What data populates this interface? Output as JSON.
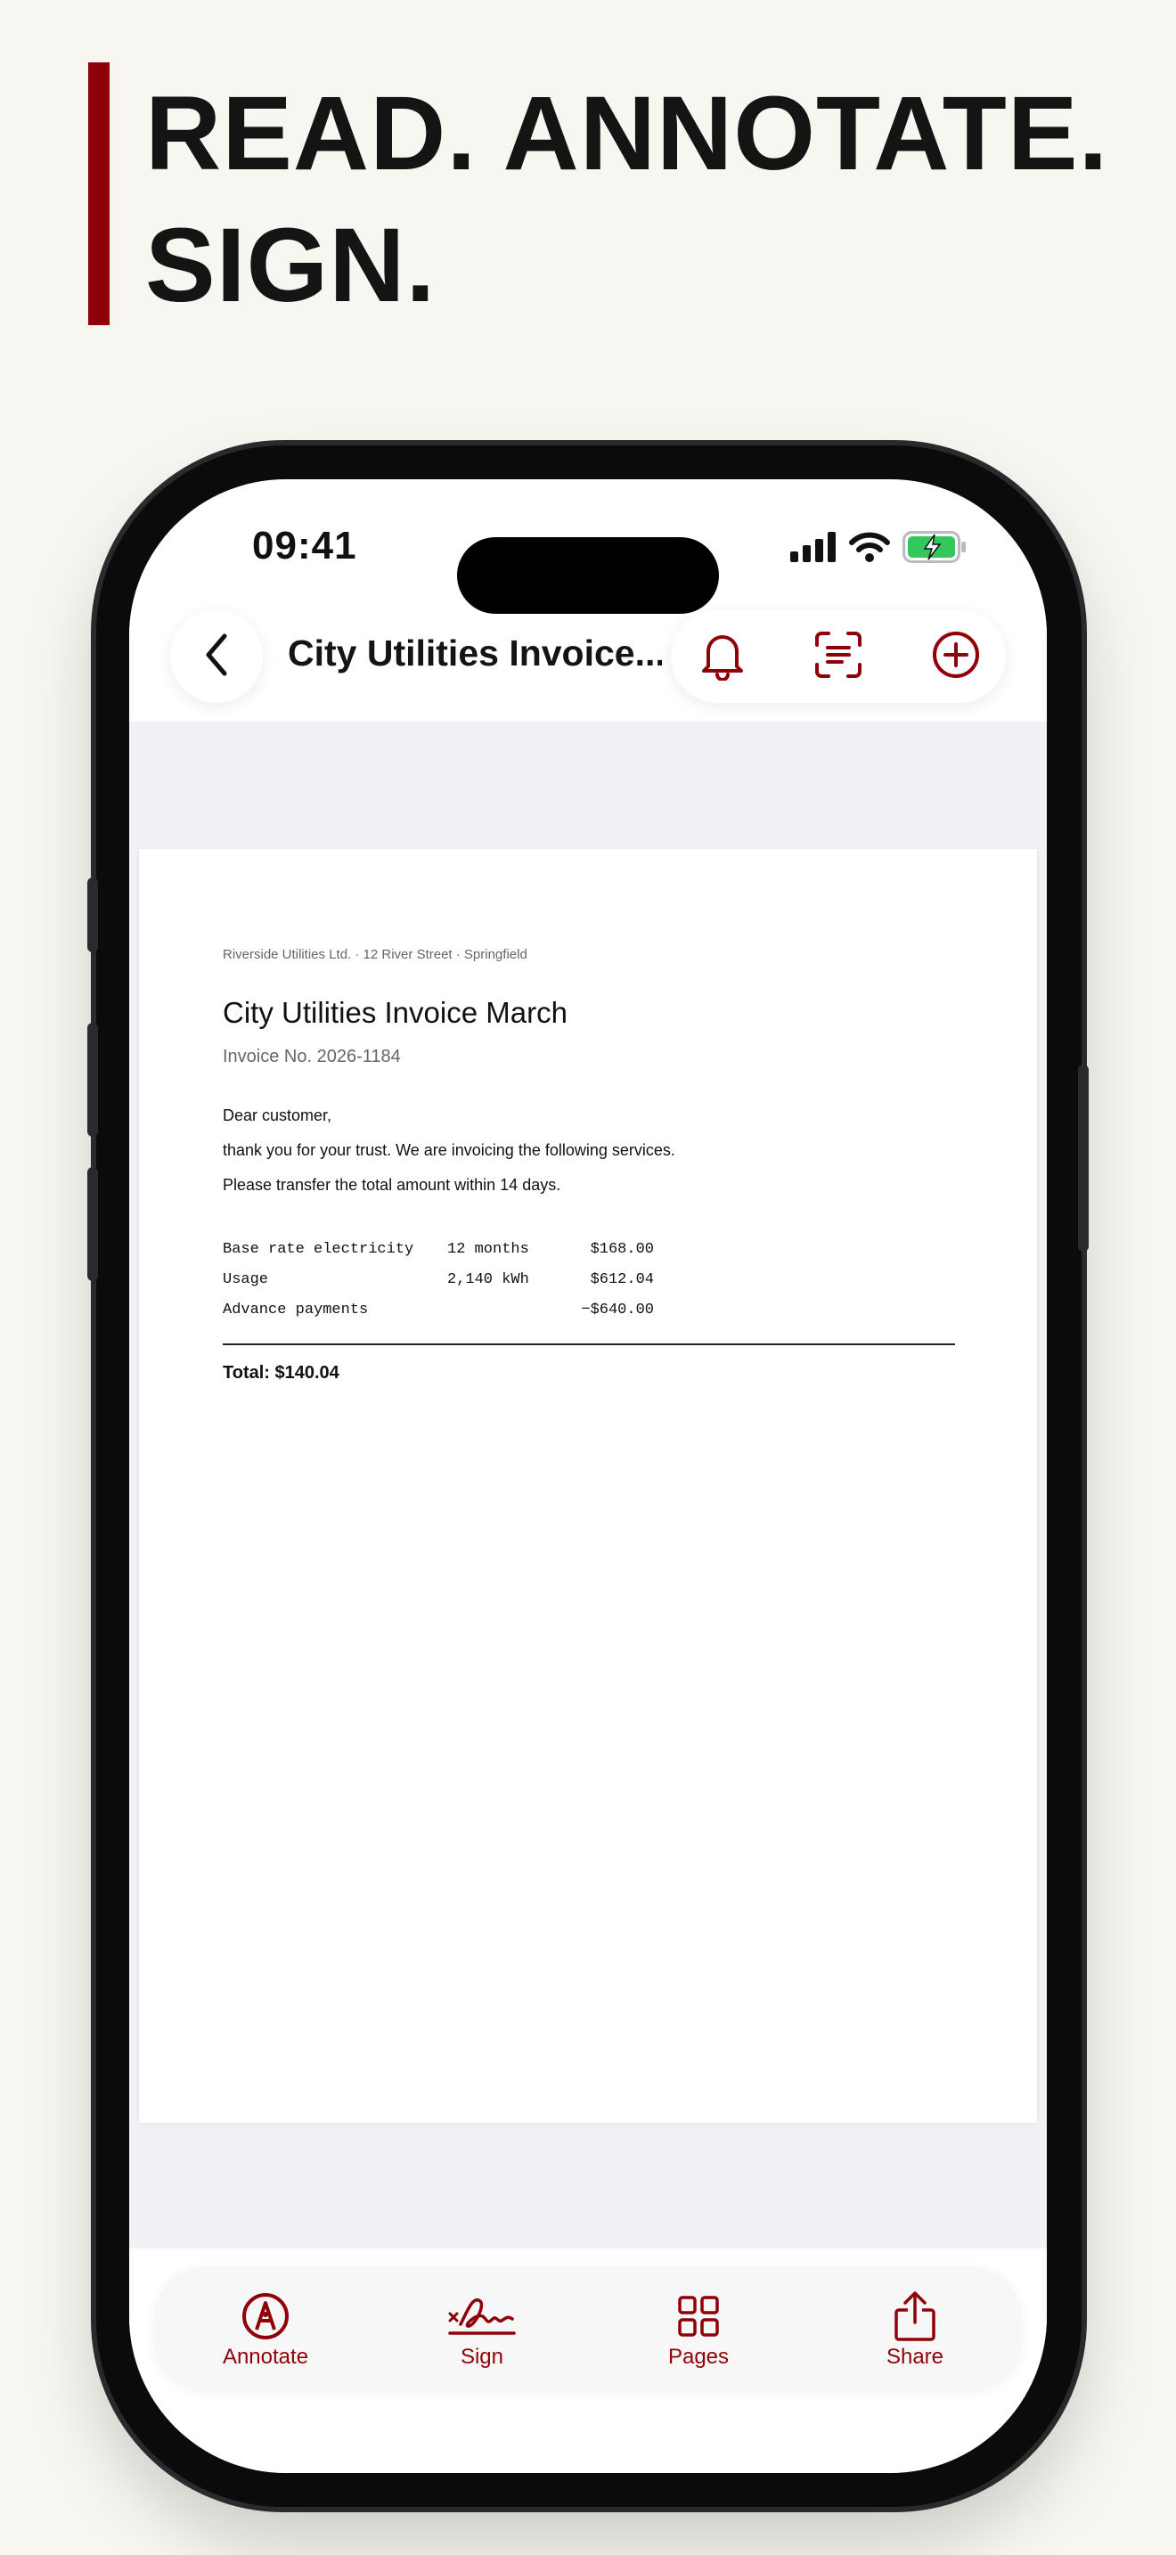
{
  "headline": {
    "line1": "READ. ANNOTATE.",
    "line2": "SIGN."
  },
  "accent_color": "#8f0009",
  "status_bar": {
    "time": "09:41",
    "icons": [
      "cellular-signal-icon",
      "wifi-icon",
      "battery-charging-icon"
    ]
  },
  "toolbar": {
    "back_icon": "chevron-left-icon",
    "document_title": "City Utilities Invoice...",
    "actions": [
      "bell-icon",
      "scan-text-icon",
      "add-circle-icon"
    ]
  },
  "document": {
    "letterhead": "Riverside Utilities Ltd. · 12 River Street · Springfield",
    "title": "City Utilities Invoice March",
    "invoice_number": "Invoice No. 2026-1184",
    "greeting": "Dear customer,",
    "body_lines": [
      "thank you for your trust. We are invoicing the following services.",
      "Please transfer the total amount within 14 days."
    ],
    "line_items": [
      {
        "description": "Base rate electricity",
        "quantity": "12 months",
        "amount": "$168.00"
      },
      {
        "description": "Usage",
        "quantity": "2,140 kWh",
        "amount": "$612.04"
      },
      {
        "description": "Advance payments",
        "quantity": "",
        "amount": "−$640.00"
      }
    ],
    "total": "Total: $140.04"
  },
  "tabbar": {
    "tabs": [
      {
        "label": "Annotate",
        "icon": "pen-circle-icon"
      },
      {
        "label": "Sign",
        "icon": "signature-icon"
      },
      {
        "label": "Pages",
        "icon": "grid-icon"
      },
      {
        "label": "Share",
        "icon": "share-icon"
      }
    ]
  }
}
